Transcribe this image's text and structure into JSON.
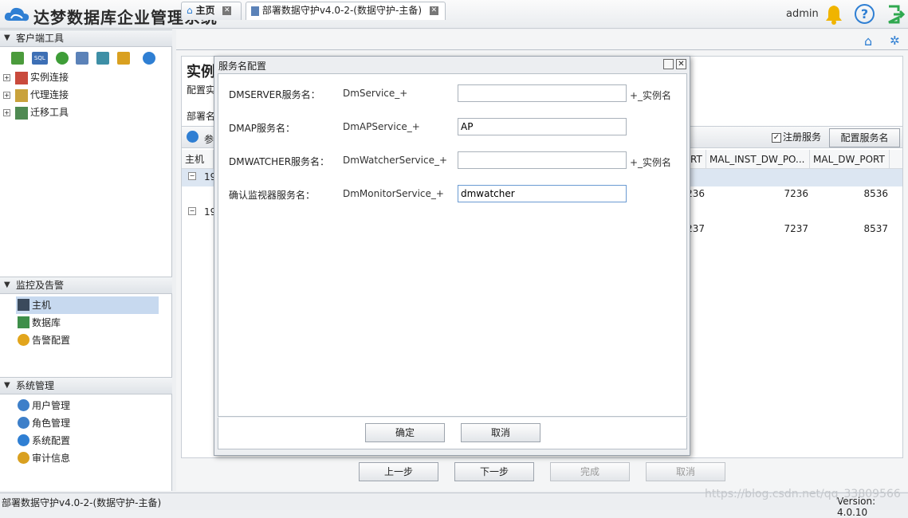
{
  "app": {
    "title": "达梦数据库企业管理系统",
    "user": "admin"
  },
  "sidebar": {
    "client_tools": {
      "header": "客户端工具",
      "tree": [
        {
          "label": "实例连接"
        },
        {
          "label": "代理连接"
        },
        {
          "label": "迁移工具"
        }
      ]
    },
    "monitoring": {
      "header": "监控及告警",
      "items": [
        {
          "label": "主机",
          "selected": true
        },
        {
          "label": "数据库"
        },
        {
          "label": "告警配置"
        }
      ]
    },
    "system": {
      "header": "系统管理",
      "items": [
        {
          "label": "用户管理"
        },
        {
          "label": "角色管理"
        },
        {
          "label": "系统配置"
        },
        {
          "label": "审计信息"
        }
      ]
    }
  },
  "tabs": [
    {
      "label": "主页"
    },
    {
      "label": "部署数据守护v4.0-2-(数据守护-主备)"
    }
  ],
  "page": {
    "heading": "实例",
    "sub": "配置实",
    "deploy_label": "部署名",
    "grid_toolbar_label": "参",
    "register_service": {
      "label": "注册服务",
      "checked": true
    },
    "config_service_button": "配置服务名",
    "columns": [
      "主机",
      "RT",
      "MAL_INST_DW_PO...",
      "MAL_DW_PORT"
    ],
    "rows": [
      {
        "host": "19",
        "rt": "236",
        "mal_inst_dw_port": "7236",
        "mal_dw_port": "8536"
      },
      {
        "host": "19",
        "rt": "237",
        "mal_inst_dw_port": "7237",
        "mal_dw_port": "8537"
      }
    ]
  },
  "wizard": {
    "prev": "上一步",
    "next": "下一步",
    "finish": "完成",
    "cancel": "取消"
  },
  "dialog": {
    "title": "服务名配置",
    "fields": [
      {
        "label": "DMSERVER服务名：",
        "prefix": "DmService_+",
        "value": "",
        "suffix": "+_实例名"
      },
      {
        "label": "DMAP服务名：",
        "prefix": "DmAPService_+",
        "value": "AP",
        "suffix": ""
      },
      {
        "label": "DMWATCHER服务名：",
        "prefix": "DmWatcherService_+",
        "value": "",
        "suffix": "+_实例名"
      },
      {
        "label": "确认监视器服务名：",
        "prefix": "DmMonitorService_+",
        "value": "dmwatcher",
        "suffix": ""
      }
    ],
    "ok": "确定",
    "cancel": "取消"
  },
  "status": {
    "left": "部署数据守护v4.0-2-(数据守护-主备)",
    "version": "Version: 4.0.10"
  },
  "watermark": "https://blog.csdn.net/qq_33809566",
  "colors": {
    "accent": "#2f7fd3",
    "bell": "#f0b400",
    "exit": "#2fa84f",
    "selected": "#c7d9ef"
  }
}
